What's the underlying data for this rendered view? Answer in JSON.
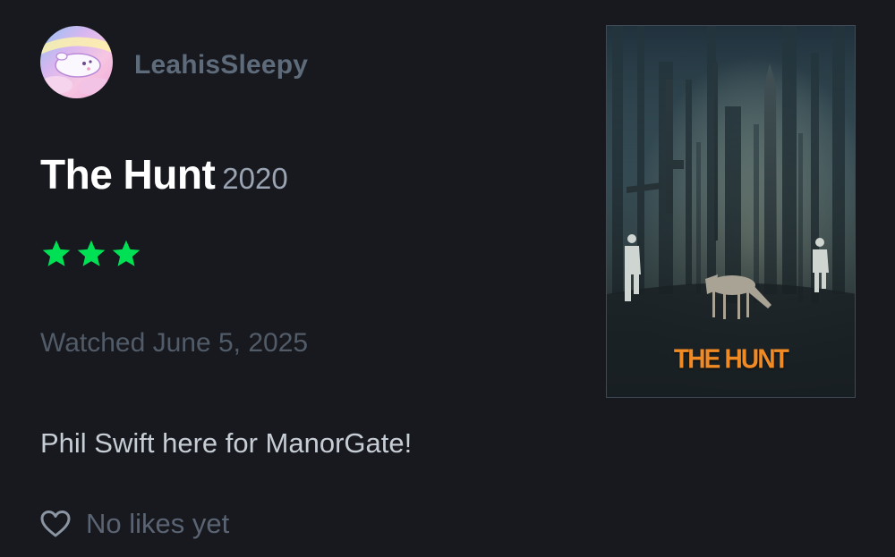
{
  "review": {
    "username": "LeahisSleepy",
    "avatar_icon": "pastel-cartoon-animal-avatar",
    "film_title": "The Hunt",
    "film_year": "2020",
    "rating_stars": 3,
    "rating_max": 5,
    "star_color": "#00e054",
    "watched_date": "Watched June 5, 2025",
    "text": "Phil Swift here for ManorGate!",
    "likes_icon": "heart-outline-icon",
    "likes_text": "No likes yet"
  },
  "poster": {
    "title_text": "THE HUNT",
    "title_color": "#f08a24"
  },
  "colors": {
    "background": "#17191e",
    "username": "#5e6b7b",
    "title": "#ffffff",
    "year": "#9aa4b2",
    "watched": "#525c69",
    "review_text": "#c6cdd5"
  }
}
